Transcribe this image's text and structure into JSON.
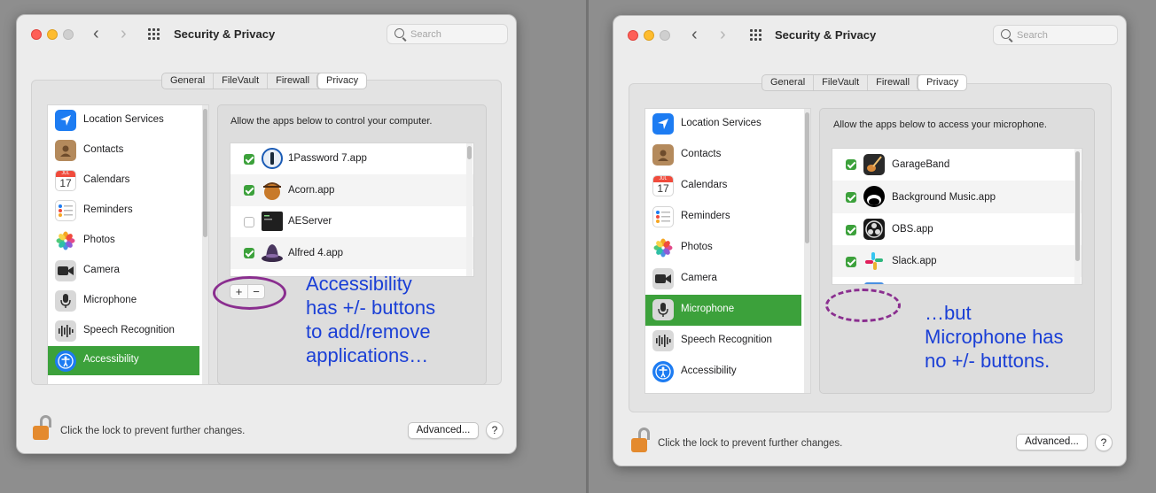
{
  "windows": [
    {
      "title": "Security & Privacy",
      "search_placeholder": "Search",
      "tabs": [
        "General",
        "FileVault",
        "Firewall",
        "Privacy"
      ],
      "active_tab": "Privacy",
      "sidebar": [
        {
          "label": "Location Services",
          "icon": "location-arrow-icon"
        },
        {
          "label": "Contacts",
          "icon": "contacts-book-icon"
        },
        {
          "label": "Calendars",
          "icon": "calendar-icon"
        },
        {
          "label": "Reminders",
          "icon": "reminders-list-icon"
        },
        {
          "label": "Photos",
          "icon": "photos-flower-icon"
        },
        {
          "label": "Camera",
          "icon": "camera-icon"
        },
        {
          "label": "Microphone",
          "icon": "microphone-icon"
        },
        {
          "label": "Speech Recognition",
          "icon": "waveform-icon"
        },
        {
          "label": "Accessibility",
          "icon": "accessibility-icon"
        }
      ],
      "selected_item": "Accessibility",
      "calendar_icon": {
        "month": "JUL",
        "day": "17"
      },
      "description": "Allow the apps below to control your computer.",
      "apps": [
        {
          "name": "1Password 7.app",
          "checked": true,
          "icon": "1password-icon"
        },
        {
          "name": "Acorn.app",
          "checked": true,
          "icon": "acorn-icon"
        },
        {
          "name": "AEServer",
          "checked": false,
          "icon": "terminal-exec-icon"
        },
        {
          "name": "Alfred 4.app",
          "checked": true,
          "icon": "alfred-hat-icon"
        }
      ],
      "add_symbol": "+",
      "remove_symbol": "−",
      "lock_text": "Click the lock to prevent further changes.",
      "advanced_label": "Advanced...",
      "help_label": "?"
    },
    {
      "title": "Security & Privacy",
      "search_placeholder": "Search",
      "tabs": [
        "General",
        "FileVault",
        "Firewall",
        "Privacy"
      ],
      "active_tab": "Privacy",
      "sidebar": [
        {
          "label": "Location Services",
          "icon": "location-arrow-icon"
        },
        {
          "label": "Contacts",
          "icon": "contacts-book-icon"
        },
        {
          "label": "Calendars",
          "icon": "calendar-icon"
        },
        {
          "label": "Reminders",
          "icon": "reminders-list-icon"
        },
        {
          "label": "Photos",
          "icon": "photos-flower-icon"
        },
        {
          "label": "Camera",
          "icon": "camera-icon"
        },
        {
          "label": "Microphone",
          "icon": "microphone-icon"
        },
        {
          "label": "Speech Recognition",
          "icon": "waveform-icon"
        },
        {
          "label": "Accessibility",
          "icon": "accessibility-icon"
        }
      ],
      "selected_item": "Microphone",
      "calendar_icon": {
        "month": "JUL",
        "day": "17"
      },
      "description": "Allow the apps below to access your microphone.",
      "apps": [
        {
          "name": "GarageBand",
          "checked": true,
          "icon": "guitar-icon"
        },
        {
          "name": "Background Music.app",
          "checked": true,
          "icon": "background-music-icon"
        },
        {
          "name": "OBS.app",
          "checked": true,
          "icon": "obs-icon"
        },
        {
          "name": "Slack.app",
          "checked": true,
          "icon": "slack-icon"
        }
      ],
      "lock_text": "Click the lock to prevent further changes.",
      "advanced_label": "Advanced...",
      "help_label": "?"
    }
  ],
  "annotations": {
    "left": [
      "Accessibility",
      "has +/- buttons",
      "to add/remove",
      "applications…"
    ],
    "right": [
      "…but",
      "Microphone has",
      "no +/- buttons."
    ]
  },
  "colors": {
    "selected_green": "#3ca13b",
    "annotation_blue": "#1a3fd6",
    "circle_purple": "#8a2e8f",
    "traffic_red": "#fe5f57",
    "traffic_yellow": "#febc2e"
  }
}
